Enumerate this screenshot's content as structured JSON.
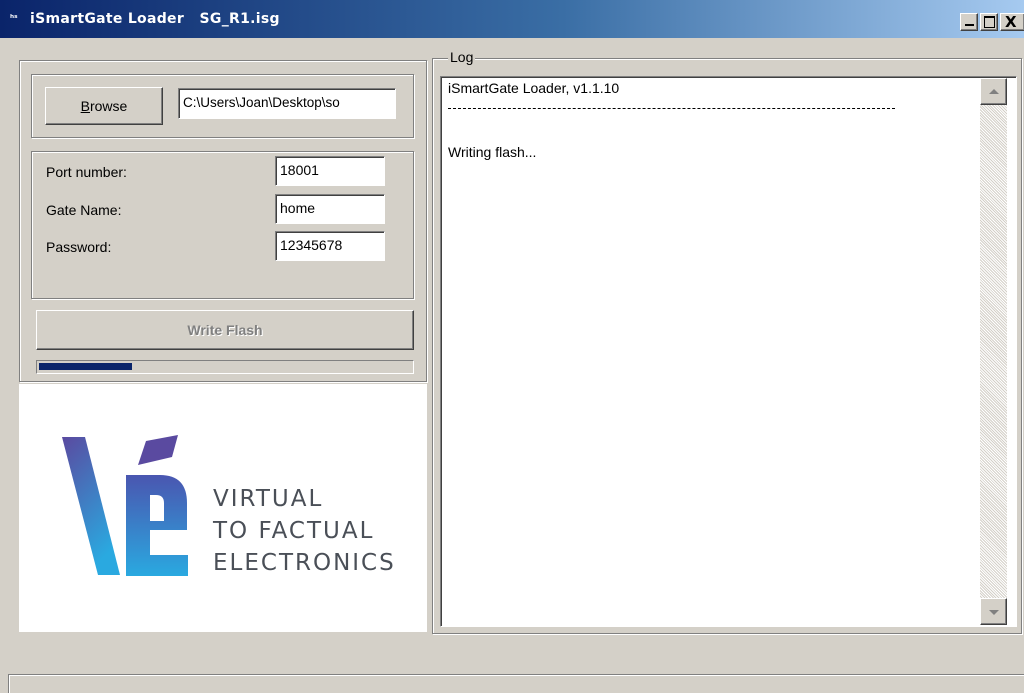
{
  "window": {
    "app_icon": "ʰˢ",
    "title": "iSmartGate Loader   SG_R1.isg",
    "minimize_icon": "minimize-icon",
    "maximize_icon": "maximize-icon",
    "close_glyph": "X"
  },
  "source": {
    "browse_label_underlined": "B",
    "browse_label_rest": "rowse",
    "path_value": "C:\\Users\\Joan\\Desktop\\so"
  },
  "settings": {
    "port_label": "Port number:",
    "port_value": "18001",
    "gate_label": "Gate Name:",
    "gate_value": "home",
    "password_label": "Password:",
    "password_value": "12345678"
  },
  "write_flash": {
    "label": "Write Flash",
    "enabled": false,
    "progress": 0.25
  },
  "logo": {
    "line1": "VIRTUAL",
    "line2": "TO FACTUAL",
    "line3": "ELECTRONICS",
    "colors": {
      "primary": "#3a64b5",
      "accent": "#2aa9e0",
      "dark": "#5a4aa0"
    }
  },
  "log": {
    "legend": "Log",
    "lines": [
      "iSmartGate Loader, v1.1.10",
      "Writing flash..."
    ]
  },
  "theme": {
    "face": "#d4d0c8",
    "titlebar": "#0a246a",
    "progress": "#0a246a"
  }
}
